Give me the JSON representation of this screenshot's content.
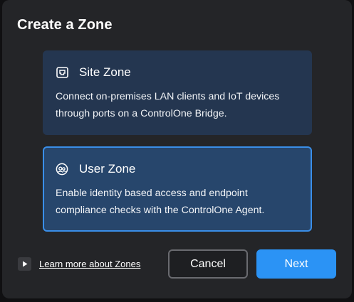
{
  "dialog": {
    "title": "Create a Zone"
  },
  "zones": [
    {
      "id": "site",
      "icon": "network-port-icon",
      "title": "Site Zone",
      "description": "Connect on-premises LAN clients and IoT devices through ports on a ControlOne Bridge.",
      "selected": false
    },
    {
      "id": "user",
      "icon": "users-icon",
      "title": "User Zone",
      "description": "Enable identity based access and endpoint compliance checks with the ControlOne Agent.",
      "selected": true
    }
  ],
  "footer": {
    "learn_more_icon": "play-icon",
    "learn_more_label": "Learn more about Zones",
    "cancel_label": "Cancel",
    "next_label": "Next"
  },
  "colors": {
    "dialog_bg": "#242528",
    "card_bg": "#243650",
    "card_selected_bg": "#27466c",
    "card_selected_border": "#3a8ee8",
    "primary_button": "#2b93f5"
  }
}
